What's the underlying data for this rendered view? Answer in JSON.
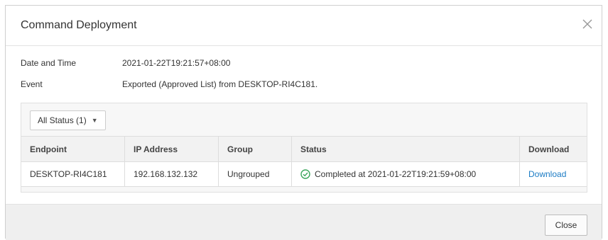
{
  "dialog": {
    "title": "Command Deployment",
    "close_icon": "close-icon"
  },
  "info": {
    "date_label": "Date and Time",
    "date_value": "2021-01-22T19:21:57+08:00",
    "event_label": "Event",
    "event_value": "Exported (Approved List) from DESKTOP-RI4C181."
  },
  "filter": {
    "label": "All Status (1)",
    "icon": "caret-down-icon"
  },
  "table": {
    "columns": [
      "Endpoint",
      "IP Address",
      "Group",
      "Status",
      "Download"
    ],
    "rows": [
      {
        "endpoint": "DESKTOP-RI4C181",
        "ip": "192.168.132.132",
        "group": "Ungrouped",
        "status": "Completed at 2021-01-22T19:21:59+08:00",
        "status_icon": "check-circle-icon",
        "download": "Download"
      }
    ]
  },
  "footer": {
    "close_label": "Close"
  },
  "colors": {
    "accent": "#1b7bc4",
    "success": "#3aa65b"
  }
}
